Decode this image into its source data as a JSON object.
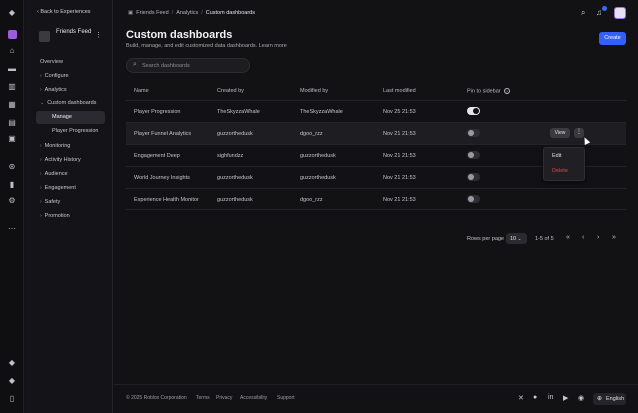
{
  "nav": {
    "back_label": "Back to Experiences",
    "experience_name": "Friends Feed",
    "more_icon": "⋮",
    "items": [
      {
        "label": "Overview"
      },
      {
        "label": "Configure",
        "chevron": "›"
      },
      {
        "label": "Analytics",
        "chevron": "›"
      },
      {
        "label": "Custom dashboards",
        "chevron": "⌄"
      },
      {
        "label": "Manage"
      },
      {
        "label": "Player Progression"
      },
      {
        "label": "Monitoring",
        "chevron": "›"
      },
      {
        "label": "Activity History",
        "chevron": "›"
      },
      {
        "label": "Audience",
        "chevron": "›"
      },
      {
        "label": "Engagement",
        "chevron": "›"
      },
      {
        "label": "Safety",
        "chevron": "›"
      },
      {
        "label": "Promotion",
        "chevron": "›"
      }
    ]
  },
  "breadcrumb": {
    "items": [
      "Friends Feed",
      "Analytics",
      "Custom dashboards"
    ],
    "separator": "/"
  },
  "page": {
    "title": "Custom dashboards",
    "subtitle": "Build, manage, and edit customized data dashboards. Learn more",
    "create_label": "Create",
    "search_placeholder": "Search dashboards"
  },
  "table": {
    "columns": [
      "Name",
      "Created by",
      "Modified by",
      "Last modified",
      "Pin to sidebar"
    ],
    "rows": [
      {
        "name": "Player Progression",
        "created_by": "TheSkyzzaWhale",
        "modified_by": "TheSkyzzaWhale",
        "last_modified": "Nov 25 21:53",
        "pinned": true
      },
      {
        "name": "Player Funnel Analytics",
        "created_by": "guzzorthedusk",
        "modified_by": "dgoo_rzz",
        "last_modified": "Nov 21 21:53",
        "pinned": false
      },
      {
        "name": "Engagement Deep",
        "created_by": "sighfundzz",
        "modified_by": "guzzorthedusk",
        "last_modified": "Nov 21 21:53",
        "pinned": false
      },
      {
        "name": "World Journey Insights",
        "created_by": "guzzorthedusk",
        "modified_by": "guzzorthedusk",
        "last_modified": "Nov 21 21:53",
        "pinned": false
      },
      {
        "name": "Experience Health Monitor",
        "created_by": "guzzorthedusk",
        "modified_by": "dgoo_rzz",
        "last_modified": "Nov 21 21:53",
        "pinned": false
      }
    ],
    "row_actions": {
      "view_label": "View",
      "more_icon": "⋮"
    }
  },
  "context_menu": {
    "edit_label": "Edit",
    "delete_label": "Delete",
    "delete_color": "#e0474c"
  },
  "pagination": {
    "rows_per_page_label": "Rows per page",
    "rows_per_page_value": "10",
    "range_label": "1-5 of 5",
    "first_icon": "«",
    "prev_icon": "‹",
    "next_icon": "›",
    "last_icon": "»"
  },
  "footer": {
    "copyright": "© 2025 Roblox Corporation",
    "links": [
      "Terms",
      "Privacy",
      "Accessibility",
      "Support"
    ],
    "language": "English"
  },
  "colors": {
    "accent": "#335fff",
    "background": "#121215",
    "notification": "#3c6af0"
  }
}
